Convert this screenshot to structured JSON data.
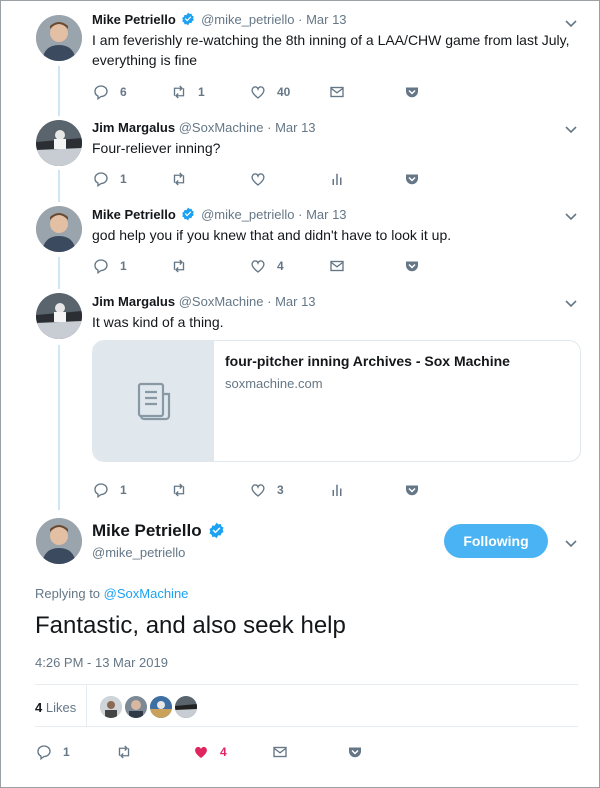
{
  "tweets": [
    {
      "name": "Mike Petriello",
      "handle": "@mike_petriello",
      "date": "Mar 13",
      "verified": true,
      "text": "I am feverishly re-watching the 8th inning of a LAA/CHW game from last July, everything is fine",
      "replies": "6",
      "retweets": "1",
      "likes": "40"
    },
    {
      "name": "Jim Margalus",
      "handle": "@SoxMachine",
      "date": "Mar 13",
      "verified": false,
      "text": "Four-reliever inning?",
      "replies": "1",
      "retweets": "",
      "likes": ""
    },
    {
      "name": "Mike Petriello",
      "handle": "@mike_petriello",
      "date": "Mar 13",
      "verified": true,
      "text": "god help you if you knew that and didn't have to look it up.",
      "replies": "1",
      "retweets": "",
      "likes": "4"
    },
    {
      "name": "Jim Margalus",
      "handle": "@SoxMachine",
      "date": "Mar 13",
      "verified": false,
      "text": "It was kind of a thing.",
      "replies": "1",
      "retweets": "",
      "likes": "3",
      "card": {
        "title": "four-pitcher inning Archives - Sox Machine",
        "domain": "soxmachine.com"
      }
    }
  ],
  "separator": "·",
  "main_tweet": {
    "name": "Mike Petriello",
    "handle": "@mike_petriello",
    "follow_label": "Following",
    "replying_prefix": "Replying to",
    "replying_to": "@SoxMachine",
    "text": "Fantastic, and also seek help",
    "timestamp": "4:26 PM - 13 Mar 2019",
    "likes_count": "4",
    "likes_label": "Likes",
    "replies": "1",
    "retweets": "",
    "likes": "4"
  },
  "colors": {
    "accent": "#1da1f2",
    "follow_button": "#4ab3f4",
    "like_active": "#e0245e",
    "secondary_text": "#657786",
    "thread_line": "#cfe6f6"
  }
}
